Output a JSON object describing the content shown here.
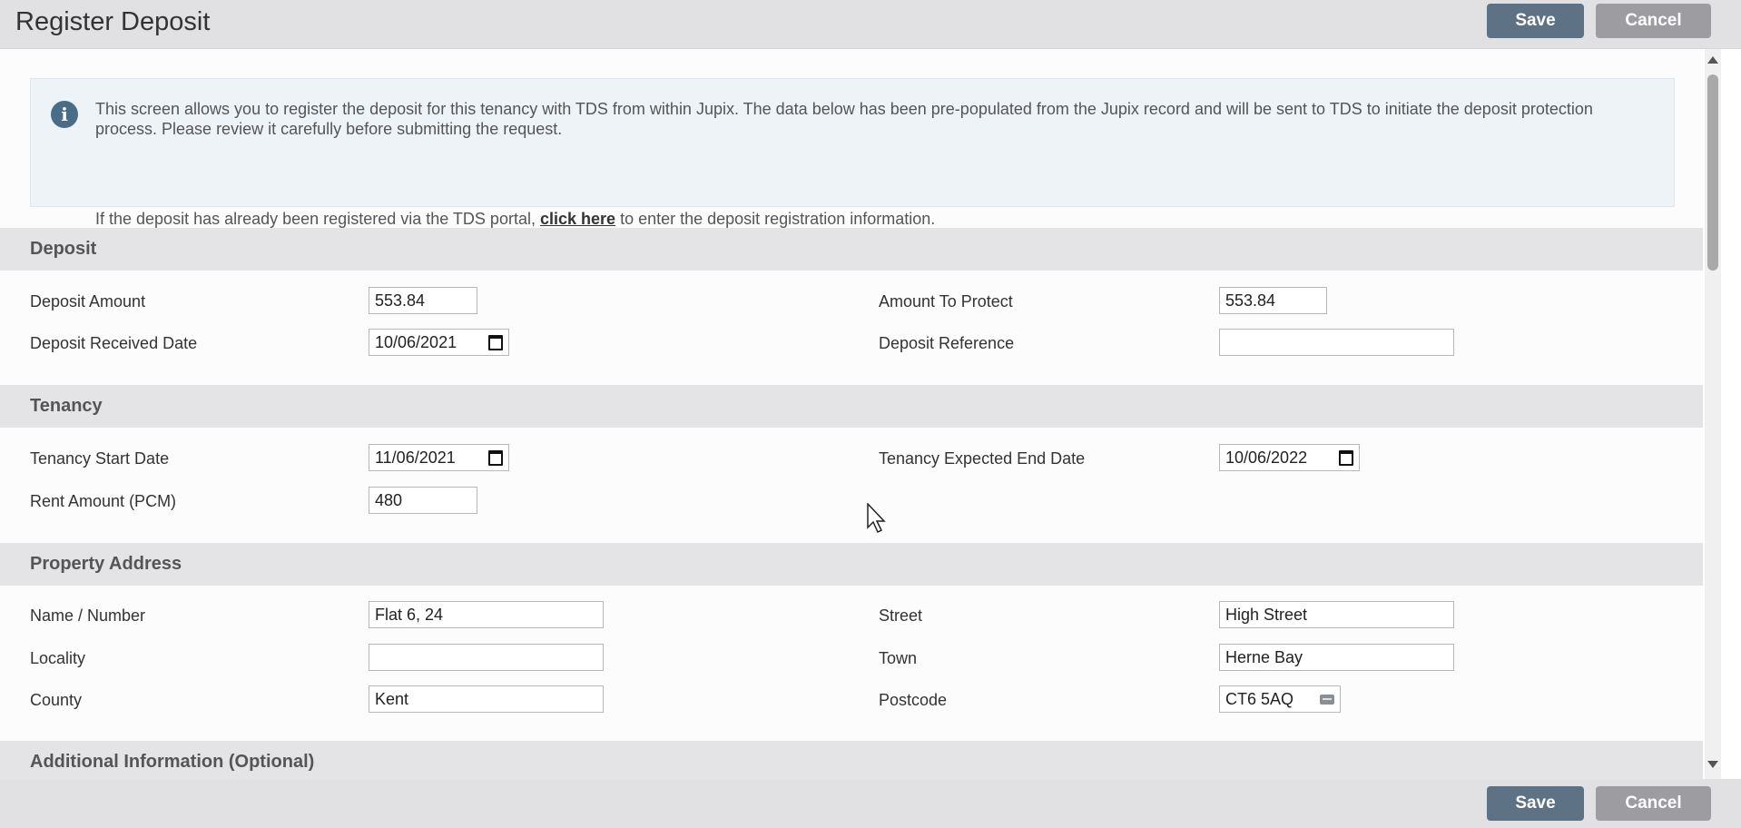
{
  "header": {
    "title": "Register Deposit",
    "save_label": "Save",
    "cancel_label": "Cancel"
  },
  "footer": {
    "save_label": "Save",
    "cancel_label": "Cancel"
  },
  "info": {
    "paragraph1": "This screen allows you to register the deposit for this tenancy with TDS from within Jupix. The data below has been pre-populated from the Jupix record and will be sent to TDS to initiate the deposit protection process. Please review it carefully before submitting the request.",
    "paragraph2_before": "If the deposit has already been registered via the TDS portal,",
    "link": "click here",
    "paragraph2_after": "to enter the deposit registration information."
  },
  "deposit": {
    "title": "Deposit",
    "deposit_amount": {
      "label": "Deposit Amount",
      "value": "553.84"
    },
    "received_date": {
      "label": "Deposit Received Date",
      "value": "10/06/2021"
    },
    "amount_to_protect": {
      "label": "Amount To Protect",
      "value": "553.84"
    },
    "reference": {
      "label": "Deposit Reference",
      "value": ""
    }
  },
  "tenancy": {
    "title": "Tenancy",
    "start_date": {
      "label": "Tenancy Start Date",
      "value": "11/06/2021"
    },
    "rent_amount": {
      "label": "Rent Amount (PCM)",
      "value": "480"
    },
    "end_date": {
      "label": "Tenancy Expected End Date",
      "value": "10/06/2022"
    }
  },
  "address": {
    "title": "Property Address",
    "name_number": {
      "label": "Name / Number",
      "value": "Flat 6, 24"
    },
    "locality": {
      "label": "Locality",
      "value": ""
    },
    "county": {
      "label": "County",
      "value": "Kent"
    },
    "street": {
      "label": "Street",
      "value": "High Street"
    },
    "town": {
      "label": "Town",
      "value": "Herne Bay"
    },
    "postcode": {
      "label": "Postcode",
      "value": "CT6 5AQ"
    }
  },
  "additional": {
    "title": "Additional Information (Optional)"
  }
}
